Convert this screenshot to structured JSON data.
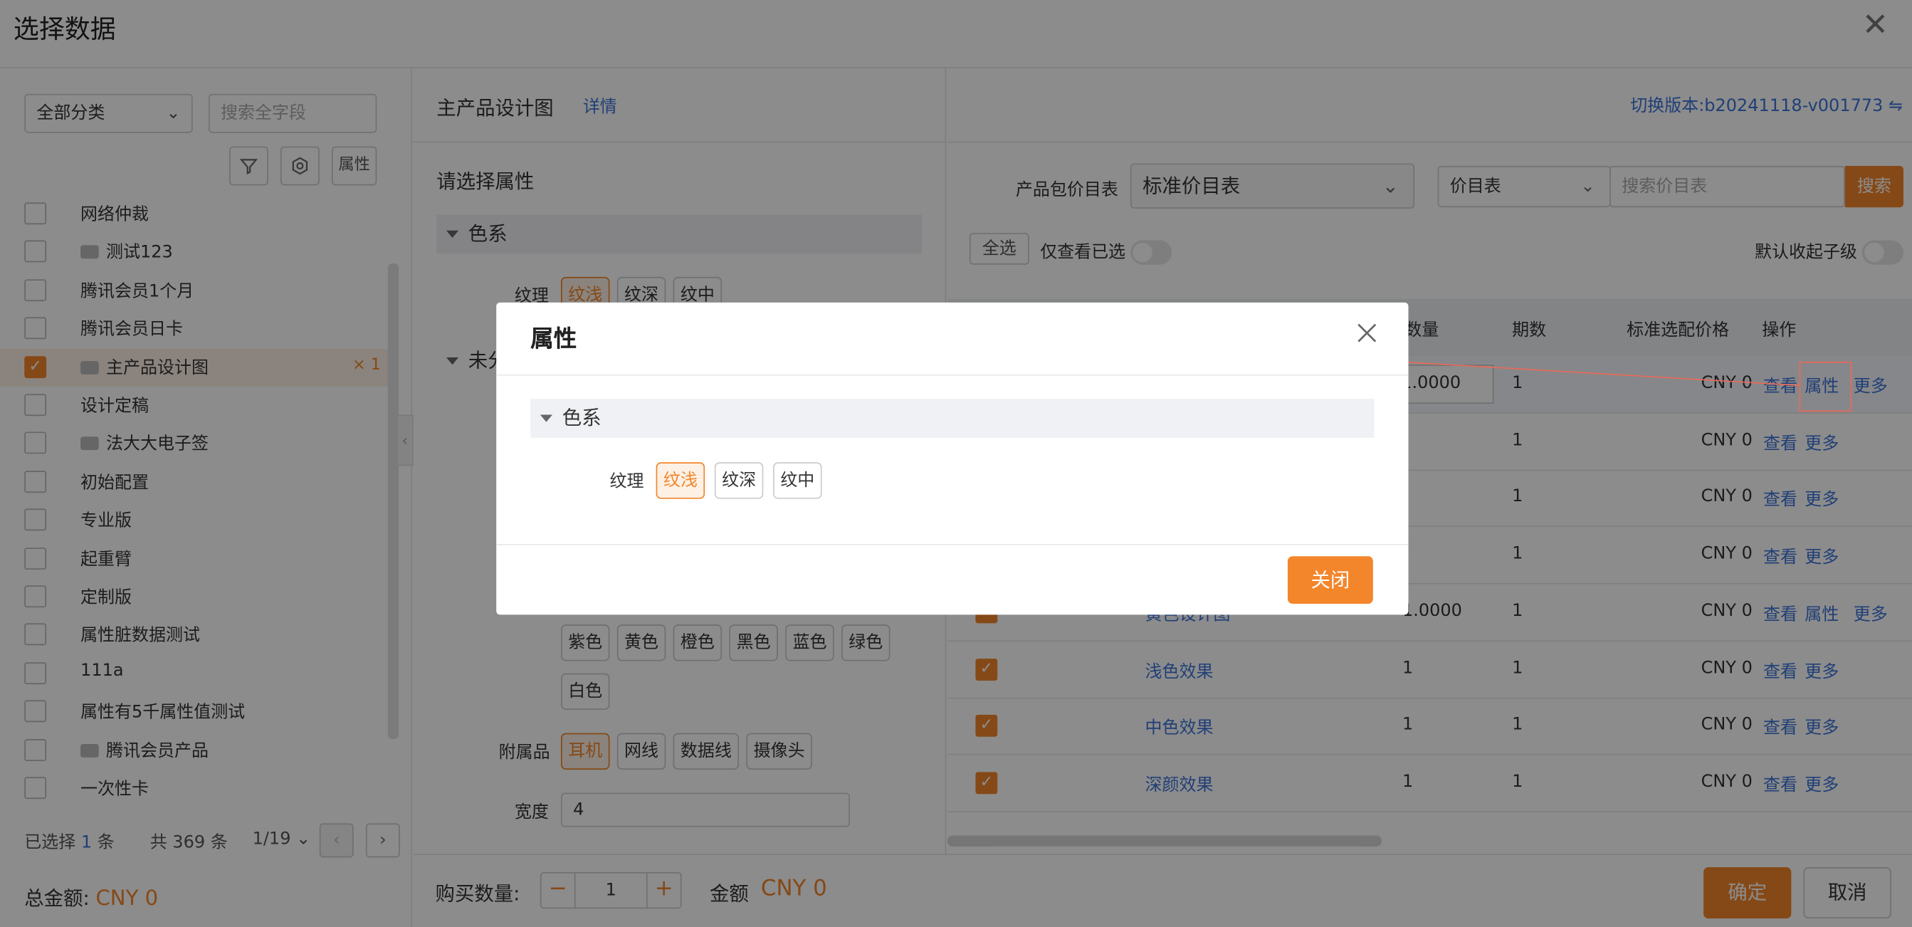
{
  "window": {
    "title": "选择数据"
  },
  "left": {
    "category_select": "全部分类",
    "search_placeholder": "搜索全字段",
    "attr_button": "属性",
    "items": [
      {
        "label": "网络仲裁",
        "folder": false,
        "checked": false
      },
      {
        "label": "测试123",
        "folder": true,
        "checked": false
      },
      {
        "label": "腾讯会员1个月",
        "folder": false,
        "checked": false
      },
      {
        "label": "腾讯会员日卡",
        "folder": false,
        "checked": false
      },
      {
        "label": "主产品设计图",
        "folder": true,
        "checked": true,
        "badge": "× 1"
      },
      {
        "label": "设计定稿",
        "folder": false,
        "checked": false
      },
      {
        "label": "法大大电子签",
        "folder": true,
        "checked": false
      },
      {
        "label": "初始配置",
        "folder": false,
        "checked": false
      },
      {
        "label": "专业版",
        "folder": false,
        "checked": false
      },
      {
        "label": "起重臂",
        "folder": false,
        "checked": false
      },
      {
        "label": "定制版",
        "folder": false,
        "checked": false
      },
      {
        "label": "属性脏数据测试",
        "folder": false,
        "checked": false
      },
      {
        "label": "111a",
        "folder": false,
        "checked": false
      },
      {
        "label": "属性有5千属性值测试",
        "folder": false,
        "checked": false
      },
      {
        "label": "腾讯会员产品",
        "folder": true,
        "checked": false
      },
      {
        "label": "一次性卡",
        "folder": false,
        "checked": false
      }
    ],
    "selected_prefix": "已选择",
    "selected_count": "1",
    "selected_suffix": "条",
    "total": "共 369 条",
    "page": "1/19",
    "total_amount_label": "总金额:",
    "total_amount_value": "CNY 0"
  },
  "middle": {
    "title": "主产品设计图",
    "detail_link": "详情",
    "prompt": "请选择属性",
    "group1": "色系",
    "texture_label": "纹理",
    "texture_options": [
      "纹浅",
      "纹深",
      "纹中"
    ],
    "group2": "未分",
    "colors_row1": [
      "紫色",
      "黄色",
      "橙色",
      "黑色",
      "蓝色",
      "绿色"
    ],
    "colors_row2": [
      "白色"
    ],
    "accessory_label": "附属品",
    "accessories": [
      "耳机",
      "网线",
      "数据线",
      "摄像头"
    ],
    "width_label": "宽度",
    "width_value": "4"
  },
  "right": {
    "version_label": "切换版本:",
    "version_value": "b20241118-v001773 ⇋",
    "pricebook_label": "产品包价目表",
    "pricebook_value": "标准价目表",
    "pricelist_select": "价目表",
    "pricelist_placeholder": "搜索价目表",
    "search_btn": "搜索",
    "select_all": "全选",
    "only_selected": "仅查看已选",
    "collapse_default": "默认收起子级",
    "headers": {
      "qty": "数量",
      "period": "期数",
      "price": "标准选配价格",
      "ops": "操作"
    },
    "rows": [
      {
        "name": "",
        "qty": "1.0000",
        "period": "1",
        "price": "CNY 0",
        "ops": [
          "查看",
          "属性",
          "更多"
        ],
        "checked": false
      },
      {
        "name": "",
        "qty": "",
        "period": "1",
        "price": "CNY 0",
        "ops": [
          "查看",
          "更多"
        ],
        "checked": false
      },
      {
        "name": "",
        "qty": "",
        "period": "1",
        "price": "CNY 0",
        "ops": [
          "查看",
          "更多"
        ],
        "checked": false
      },
      {
        "name": "",
        "qty": "",
        "period": "1",
        "price": "CNY 0",
        "ops": [
          "查看",
          "更多"
        ],
        "checked": false
      },
      {
        "name": "黄色设计图",
        "qty": "1.0000",
        "period": "1",
        "price": "CNY 0",
        "ops": [
          "查看",
          "属性",
          "更多"
        ],
        "checked": true
      },
      {
        "name": "浅色效果",
        "qty": "1",
        "period": "1",
        "price": "CNY 0",
        "ops": [
          "查看",
          "更多"
        ],
        "checked": true
      },
      {
        "name": "中色效果",
        "qty": "1",
        "period": "1",
        "price": "CNY 0",
        "ops": [
          "查看",
          "更多"
        ],
        "checked": true
      },
      {
        "name": "深颜效果",
        "qty": "1",
        "period": "1",
        "price": "CNY 0",
        "ops": [
          "查看",
          "更多"
        ],
        "checked": true
      }
    ]
  },
  "bottom": {
    "qty_label": "购买数量:",
    "qty_value": "1",
    "amount_label": "金额",
    "amount_value": "CNY 0",
    "confirm": "确定",
    "cancel": "取消"
  },
  "modal": {
    "title": "属性",
    "group": "色系",
    "field_label": "纹理",
    "options": [
      "纹浅",
      "纹深",
      "纹中"
    ],
    "selected_option": "纹浅",
    "close_btn": "关闭"
  },
  "colors": {
    "accent": "#f3862b",
    "link": "#3b73d9"
  }
}
